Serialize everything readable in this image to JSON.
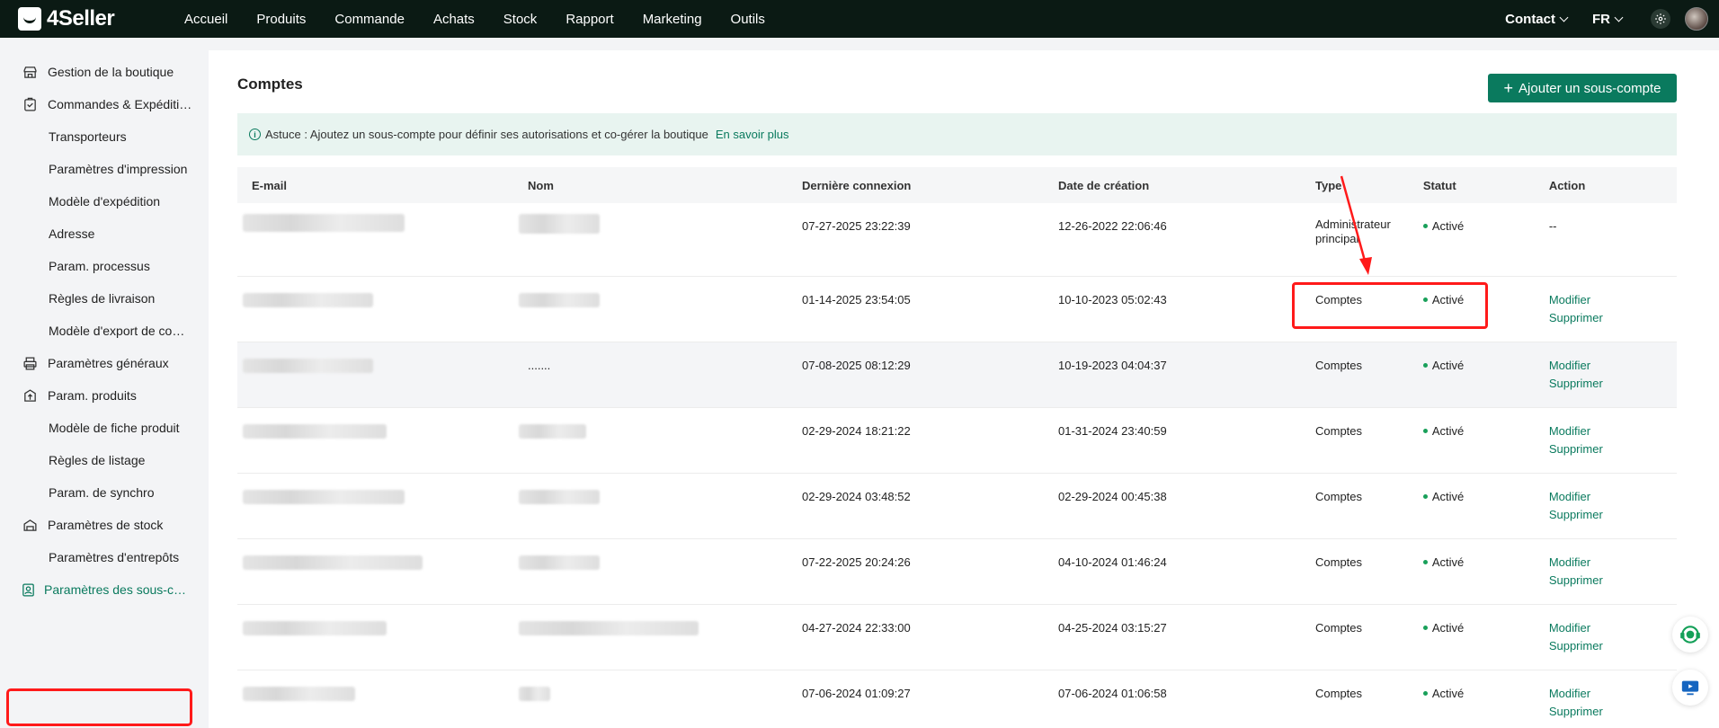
{
  "app": {
    "logo": "4Seller"
  },
  "nav": [
    "Accueil",
    "Produits",
    "Commande",
    "Achats",
    "Stock",
    "Rapport",
    "Marketing",
    "Outils"
  ],
  "header": {
    "contact": "Contact",
    "lang": "FR"
  },
  "sidebar": {
    "items": [
      {
        "label": "Gestion de la boutique",
        "icon": "shop-icon"
      },
      {
        "label": "Commandes & Expéditi…",
        "icon": "order-icon"
      },
      {
        "label": "Transporteurs"
      },
      {
        "label": "Paramètres d'impression"
      },
      {
        "label": "Modèle d'expédition"
      },
      {
        "label": "Adresse"
      },
      {
        "label": "Param. processus"
      },
      {
        "label": "Règles de livraison"
      },
      {
        "label": "Modèle d'export de co…"
      },
      {
        "label": "Paramètres généraux",
        "icon": "printer-icon"
      },
      {
        "label": "Param. produits",
        "icon": "product-upload-icon"
      },
      {
        "label": "Modèle de fiche produit"
      },
      {
        "label": "Règles de listage"
      },
      {
        "label": "Param. de synchro"
      },
      {
        "label": "Paramètres de stock",
        "icon": "warehouse-icon"
      },
      {
        "label": "Paramètres d'entrepôts"
      },
      {
        "label": "Paramètres des sous-c…",
        "icon": "sub-account-icon"
      }
    ]
  },
  "main": {
    "title": "Comptes",
    "add_button": "Ajouter un sous-compte",
    "tip": {
      "text": "Astuce : Ajoutez un sous-compte pour définir ses autorisations et co-gérer la boutique",
      "link": "En savoir plus"
    },
    "columns": [
      "E-mail",
      "Nom",
      "Dernière connexion",
      "Date de création",
      "Type",
      "Statut",
      "Action"
    ],
    "rows": [
      {
        "name": "",
        "last_login": "07-27-2025 23:22:39",
        "created": "12-26-2022 22:06:46",
        "type": "Administrateur principal",
        "status": "Activé",
        "action": "--"
      },
      {
        "name": "",
        "last_login": "01-14-2025 23:54:05",
        "created": "10-10-2023 05:02:43",
        "type": "Comptes",
        "status": "Activé",
        "modify": "Modifier",
        "delete": "Supprimer"
      },
      {
        "name": ".......",
        "last_login": "07-08-2025 08:12:29",
        "created": "10-19-2023 04:04:37",
        "type": "Comptes",
        "status": "Activé",
        "modify": "Modifier",
        "delete": "Supprimer"
      },
      {
        "name": "",
        "last_login": "02-29-2024 18:21:22",
        "created": "01-31-2024 23:40:59",
        "type": "Comptes",
        "status": "Activé",
        "modify": "Modifier",
        "delete": "Supprimer"
      },
      {
        "name": "",
        "last_login": "02-29-2024 03:48:52",
        "created": "02-29-2024 00:45:38",
        "type": "Comptes",
        "status": "Activé",
        "modify": "Modifier",
        "delete": "Supprimer"
      },
      {
        "name": "",
        "last_login": "07-22-2025 20:24:26",
        "created": "04-10-2024 01:46:24",
        "type": "Comptes",
        "status": "Activé",
        "modify": "Modifier",
        "delete": "Supprimer"
      },
      {
        "name": "",
        "last_login": "04-27-2024 22:33:00",
        "created": "04-25-2024 03:15:27",
        "type": "Comptes",
        "status": "Activé",
        "modify": "Modifier",
        "delete": "Supprimer"
      },
      {
        "name": "",
        "last_login": "07-06-2024 01:09:27",
        "created": "07-06-2024 01:06:58",
        "type": "Comptes",
        "status": "Activé",
        "modify": "Modifier",
        "delete": "Supprimer"
      }
    ]
  },
  "colors": {
    "brand": "#0a7a5e",
    "annotation": "#ff1a1a",
    "status_dot": "#19a05a"
  }
}
